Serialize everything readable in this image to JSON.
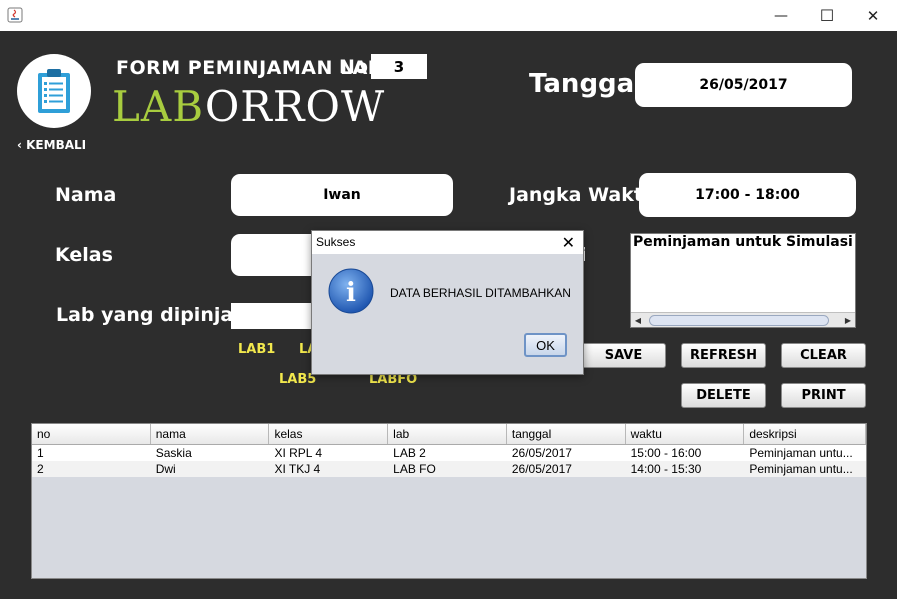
{
  "window": {
    "minimize": "—",
    "maximize": "☐",
    "close": "✕"
  },
  "header": {
    "form_title": "FORM PEMINJAMAN LAB",
    "brand_lab": "LAB",
    "brand_rest": "ORROW",
    "back_label": "KEMBALI",
    "no_label": "No",
    "no_value": "3",
    "tanggal_label": "Tanggal",
    "tanggal_value": "26/05/2017"
  },
  "form": {
    "nama_label": "Nama",
    "nama_value": "Iwan",
    "kelas_label": "Kelas",
    "kelas_value": "",
    "lab_label": "Lab yang dipinjam",
    "lab_value": "",
    "jangka_label": "Jangka Waktu",
    "jangka_value": "17:00 - 18:00",
    "deskripsi_label_fragment": "i",
    "deskripsi_value": "Peminjaman untuk Simulasi",
    "lab_options": [
      "LAB1",
      "LA",
      "LAB5",
      "LABFO"
    ]
  },
  "buttons": {
    "save": "SAVE",
    "refresh": "REFRESH",
    "clear": "CLEAR",
    "delete": "DELETE",
    "print": "PRINT"
  },
  "table": {
    "columns": [
      "no",
      "nama",
      "kelas",
      "lab",
      "tanggal",
      "waktu",
      "deskripsi"
    ],
    "rows": [
      [
        "1",
        "Saskia",
        "XI RPL 4",
        "LAB 2",
        "26/05/2017",
        "15:00 - 16:00",
        "Peminjaman untu..."
      ],
      [
        "2",
        "Dwi",
        "XI TKJ 4",
        "LAB FO",
        "26/05/2017",
        "14:00 - 15:30",
        "Peminjaman untu..."
      ]
    ]
  },
  "dialog": {
    "title": "Sukses",
    "message": "DATA BERHASIL DITAMBAHKAN",
    "ok": "OK",
    "close": "✕",
    "icon": "i"
  },
  "colors": {
    "background": "#2d2d2d",
    "brand_green": "#a8cc3f",
    "lab_option_yellow": "#f2e84d"
  }
}
